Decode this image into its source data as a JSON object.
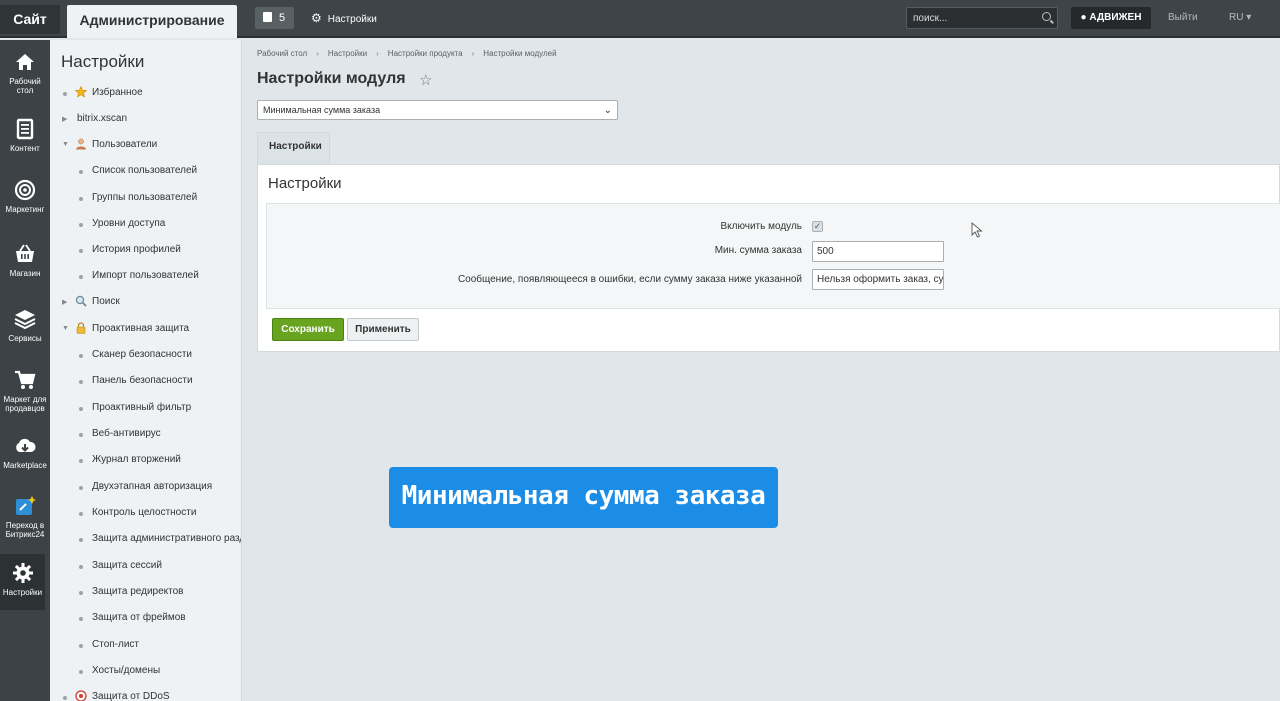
{
  "topbar": {
    "site_label": "Сайт",
    "admin_label": "Администрирование",
    "notifications_count": "5",
    "settings_label": "Настройки",
    "search_placeholder": "поиск...",
    "user_label": "АДВИЖЕН",
    "logout_label": "Выйти",
    "lang_label": "RU ▾"
  },
  "rail": {
    "items": [
      {
        "label": "Рабочий стол",
        "icon": "home-icon"
      },
      {
        "label": "Контент",
        "icon": "document-icon"
      },
      {
        "label": "Маркетинг",
        "icon": "target-icon"
      },
      {
        "label": "Магазин",
        "icon": "basket-icon"
      },
      {
        "label": "Сервисы",
        "icon": "layers-icon"
      },
      {
        "label": "Маркет для продавцов",
        "icon": "cart-icon"
      },
      {
        "label": "Marketplace",
        "icon": "cloud-download-icon"
      },
      {
        "label": "Переход в Битрикс24",
        "icon": "bitrix24-icon"
      },
      {
        "label": "Настройки",
        "icon": "gear-icon"
      }
    ]
  },
  "menu": {
    "title": "Настройки",
    "items": [
      {
        "label": "Избранное",
        "icon": "star-icon"
      },
      {
        "label": "bitrix.xscan"
      },
      {
        "label": "Пользователи",
        "icon": "user-icon"
      },
      {
        "label": "Список пользователей"
      },
      {
        "label": "Группы пользователей"
      },
      {
        "label": "Уровни доступа"
      },
      {
        "label": "История профилей"
      },
      {
        "label": "Импорт пользователей"
      },
      {
        "label": "Поиск",
        "icon": "magnifier-icon"
      },
      {
        "label": "Проактивная защита",
        "icon": "lock-icon"
      },
      {
        "label": "Сканер безопасности"
      },
      {
        "label": "Панель безопасности"
      },
      {
        "label": "Проактивный фильтр"
      },
      {
        "label": "Веб-антивирус"
      },
      {
        "label": "Журнал вторжений"
      },
      {
        "label": "Двухэтапная авторизация"
      },
      {
        "label": "Контроль целостности"
      },
      {
        "label": "Защита административного разде"
      },
      {
        "label": "Защита сессий"
      },
      {
        "label": "Защита редиректов"
      },
      {
        "label": "Защита от фреймов"
      },
      {
        "label": "Стоп-лист"
      },
      {
        "label": "Хосты/домены"
      },
      {
        "label": "Защита от DDoS",
        "icon": "shield-icon"
      }
    ]
  },
  "breadcrumbs": [
    "Рабочий стол",
    "Настройки",
    "Настройки продукта",
    "Настройки модулей"
  ],
  "page": {
    "title": "Настройки модуля",
    "module_select": "Минимальная сумма заказа",
    "tab_label": "Настройки",
    "panel_title": "Настройки"
  },
  "form": {
    "enable_label": "Включить модуль",
    "enable_checked": true,
    "min_sum_label": "Мин. сумма заказа",
    "min_sum_value": "500",
    "message_label": "Сообщение, появляющееся в ошибки, если сумму заказа ниже указанной",
    "message_value": "Нельзя оформить заказ, сум",
    "save_label": "Сохранить",
    "apply_label": "Применить"
  },
  "caption": "Минимальная сумма заказа",
  "colors": {
    "topbar": "#3e4447",
    "save_button": "#68a420",
    "caption_bg": "#1c8de6"
  }
}
